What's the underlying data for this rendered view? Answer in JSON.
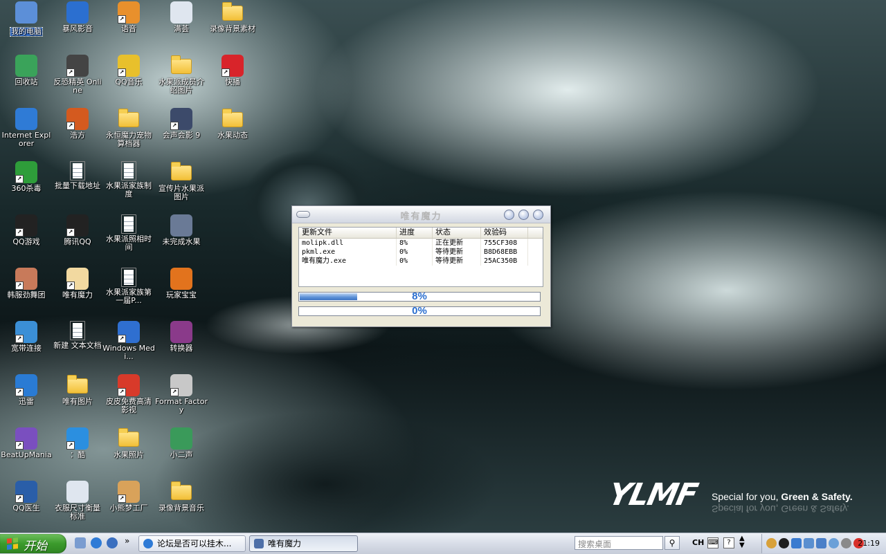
{
  "desktop": {
    "icons": [
      {
        "label": "我的电脑",
        "icon": "my-computer-icon",
        "shortcut": false,
        "selected": true,
        "color": "#5c8fd8"
      },
      {
        "label": "回收站",
        "icon": "recycle-bin-icon",
        "shortcut": false,
        "color": "#3aa35a"
      },
      {
        "label": "Internet Explorer",
        "icon": "internet-explorer-icon",
        "shortcut": false,
        "color": "#2f7bd6"
      },
      {
        "label": "360杀毒",
        "icon": "360-antivirus-icon",
        "shortcut": true,
        "color": "#2e9d3a"
      },
      {
        "label": "QQ游戏",
        "icon": "qq-game-icon",
        "shortcut": true,
        "color": "#222"
      },
      {
        "label": "韩服劲舞团",
        "icon": "audition-game-icon",
        "shortcut": true,
        "color": "#c87a5a"
      },
      {
        "label": "宽带连接",
        "icon": "broadband-connection-icon",
        "shortcut": true,
        "color": "#3b8fd6"
      },
      {
        "label": "迅雷",
        "icon": "thunder-icon",
        "shortcut": true,
        "color": "#2a7bd4"
      },
      {
        "label": "BeatUpMania",
        "icon": "beatupmania-icon",
        "shortcut": true,
        "color": "#7a4fbf"
      },
      {
        "label": "QQ医生",
        "icon": "qq-doctor-icon",
        "shortcut": true,
        "color": "#2a5ea8"
      },
      {
        "label": "暴风影音",
        "icon": "storm-player-icon",
        "shortcut": false,
        "color": "#2b6fd0"
      },
      {
        "label": "反恐精英 Online",
        "icon": "counter-strike-icon",
        "shortcut": true,
        "color": "#444"
      },
      {
        "label": "浩方",
        "icon": "haofang-icon",
        "shortcut": true,
        "color": "#d45a1f"
      },
      {
        "label": "批量下载地址",
        "icon": "text-document-icon",
        "shortcut": false,
        "doc": true
      },
      {
        "label": "腾讯QQ",
        "icon": "tencent-qq-icon",
        "shortcut": true,
        "color": "#222"
      },
      {
        "label": "唯有魔力",
        "icon": "cat-icon",
        "shortcut": true,
        "color": "#f2d9a0"
      },
      {
        "label": "新建 文本文档",
        "icon": "text-document-icon",
        "shortcut": false,
        "doc": true
      },
      {
        "label": "唯有图片",
        "icon": "folder-icon",
        "shortcut": false,
        "folder": true
      },
      {
        "label": "：酷",
        "icon": "kugou-player-icon",
        "shortcut": true,
        "color": "#2b8fe0"
      },
      {
        "label": "衣服尺寸衡量标准",
        "icon": "jpg-image-icon",
        "shortcut": false,
        "color": "#dfe6ef"
      },
      {
        "label": "语音",
        "icon": "voice-chat-icon",
        "shortcut": true,
        "color": "#e8902c"
      },
      {
        "label": "QQ音乐",
        "icon": "qq-music-icon",
        "shortcut": true,
        "color": "#e8c02c"
      },
      {
        "label": "永恒魔力宠物算档器",
        "icon": "folder-icon",
        "shortcut": false,
        "folder": true
      },
      {
        "label": "水果派家族制度",
        "icon": "text-document-icon",
        "shortcut": false,
        "doc": true
      },
      {
        "label": "水果派照相时间",
        "icon": "text-document-icon",
        "shortcut": false,
        "doc": true
      },
      {
        "label": "水果派家族第一届P...",
        "icon": "text-document-icon",
        "shortcut": false,
        "doc": true
      },
      {
        "label": "Windows Medi...",
        "icon": "windows-media-player-icon",
        "shortcut": true,
        "color": "#2f6fd0"
      },
      {
        "label": "皮皮免费高清影视",
        "icon": "pipi-video-icon",
        "shortcut": true,
        "color": "#d83a2a"
      },
      {
        "label": "水果照片",
        "icon": "folder-icon",
        "shortcut": false,
        "folder": true
      },
      {
        "label": "小熊梦工厂",
        "icon": "bear-icon",
        "shortcut": true,
        "color": "#d9a25a"
      },
      {
        "label": "满荟",
        "icon": "jpg-image-icon",
        "shortcut": false,
        "color": "#dfe6ef"
      },
      {
        "label": "水果派成员介绍图片",
        "icon": "folder-icon",
        "shortcut": false,
        "folder": true
      },
      {
        "label": "会声会影 9",
        "icon": "ulead-video-icon",
        "shortcut": true,
        "color": "#3c4a6a"
      },
      {
        "label": "宣传片水果派图片",
        "icon": "folder-icon",
        "shortcut": false,
        "folder": true
      },
      {
        "label": "未完成水果",
        "icon": "image-file-icon",
        "shortcut": false,
        "color": "#6a7a96"
      },
      {
        "label": "玩家宝宝",
        "icon": "player-baby-icon",
        "shortcut": false,
        "color": "#e2731d"
      },
      {
        "label": "转换器",
        "icon": "winrar-icon",
        "shortcut": false,
        "color": "#8a3a8a"
      },
      {
        "label": "Format Factory",
        "icon": "format-factory-icon",
        "shortcut": true,
        "color": "#c8c8c8"
      },
      {
        "label": "小二声",
        "icon": "avi-file-icon",
        "shortcut": false,
        "color": "#3a9a5a"
      },
      {
        "label": "录像背景音乐",
        "icon": "folder-icon",
        "shortcut": false,
        "folder": true
      },
      {
        "label": "录像背景素材",
        "icon": "folder-icon",
        "shortcut": false,
        "folder": true
      },
      {
        "label": "快播",
        "icon": "qvod-player-icon",
        "shortcut": true,
        "color": "#d8242a"
      },
      {
        "label": "水果动态",
        "icon": "folder-icon",
        "shortcut": false,
        "folder": true
      }
    ]
  },
  "brand": {
    "logo": "YLMF",
    "slogan_pre": "Special for you, ",
    "slogan_bold": "Green & Safety."
  },
  "update_window": {
    "title": "唯有魔力",
    "columns": [
      "更新文件",
      "进度",
      "状态",
      "效验码"
    ],
    "rows": [
      [
        "molipk.dll",
        "8%",
        "正在更新",
        "755CF308"
      ],
      [
        "pkml.exe",
        "0%",
        "等待更新",
        "B8D68EBB"
      ],
      [
        "唯有魔力.exe",
        "0%",
        "等待更新",
        "25AC350B"
      ]
    ],
    "progress_file_label": "8%",
    "progress_file_value": 0.08,
    "progress_total_label": "0%",
    "progress_total_value": 0.0
  },
  "taskbar": {
    "start_label": "开始",
    "tasks": [
      {
        "label": "论坛是否可以挂木...",
        "icon": "internet-explorer-icon",
        "active": false
      },
      {
        "label": "唯有魔力",
        "icon": "app-window-icon",
        "active": true
      }
    ],
    "search_placeholder": "搜索桌面",
    "language": "CH",
    "clock": "21:19"
  },
  "colors": {
    "start_green": "#3b9a2c",
    "progress_blue": "#2a6fd0",
    "selection_blue": "#316ac5"
  }
}
